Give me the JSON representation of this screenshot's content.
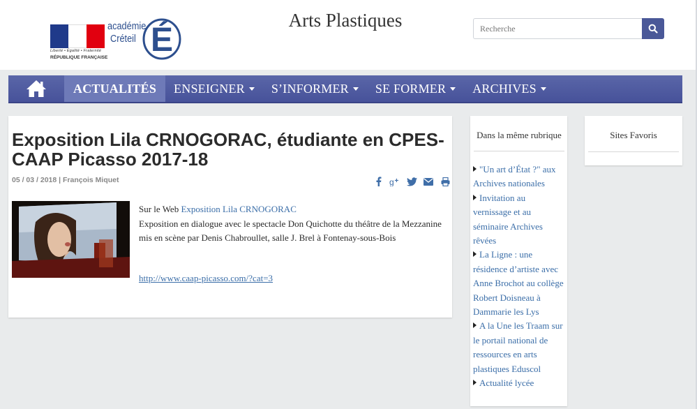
{
  "header": {
    "site_title": "Arts Plastiques",
    "logo": {
      "line1": "académie",
      "line2": "Créteil",
      "motto": "Liberté • Égalité • Fraternité",
      "republic": "RÉPUBLIQUE FRANÇAISE"
    },
    "search": {
      "placeholder": "Recherche",
      "icon": "search-icon"
    }
  },
  "nav": {
    "home_icon": "home-icon",
    "items": [
      {
        "label": "ACTUALITÉS",
        "active": true,
        "dropdown": false
      },
      {
        "label": "ENSEIGNER",
        "dropdown": true
      },
      {
        "label": "S’INFORMER",
        "dropdown": true
      },
      {
        "label": "SE FORMER",
        "dropdown": true
      },
      {
        "label": "ARCHIVES",
        "dropdown": true
      }
    ]
  },
  "article": {
    "title": "Exposition Lila CRNOGORAC, étudiante en CPES-CAAP Picasso 2017-18",
    "meta": "05 / 03 / 2018 | François Miquet",
    "share_icons": [
      "facebook-icon",
      "google-plus-icon",
      "twitter-icon",
      "email-icon",
      "print-icon"
    ],
    "body_prefix": "Sur le Web ",
    "body_link": "Exposition Lila CRNOGORAC",
    "body_text": "Exposition en dialogue avec le spectacle Don Quichotte du théâtre de la Mezzanine mis en scène par Denis Chabroullet, salle J. Brel à Fontenay-sous-Bois",
    "url": "http://www.caap-picasso.com/?cat=3"
  },
  "sidebar": {
    "rubrique_title": "Dans la même rubrique",
    "items": [
      "\"Un art d’État ?\" aux Archives nationales",
      "Invitation au vernissage et au séminaire Archives rêvées",
      "La Ligne : une résidence d’artiste avec Anne Brochot au collège Robert Doisneau à Dammarie les Lys",
      "A la Une les Traam sur le portail national de ressources en arts plastiques Eduscol",
      "Actualité lycée"
    ],
    "favoris_title": "Sites Favoris"
  },
  "colors": {
    "nav": "#4d5a9e",
    "nav_active": "#6e7ab8",
    "link": "#3b6ea8",
    "background": "#e9ebec"
  }
}
